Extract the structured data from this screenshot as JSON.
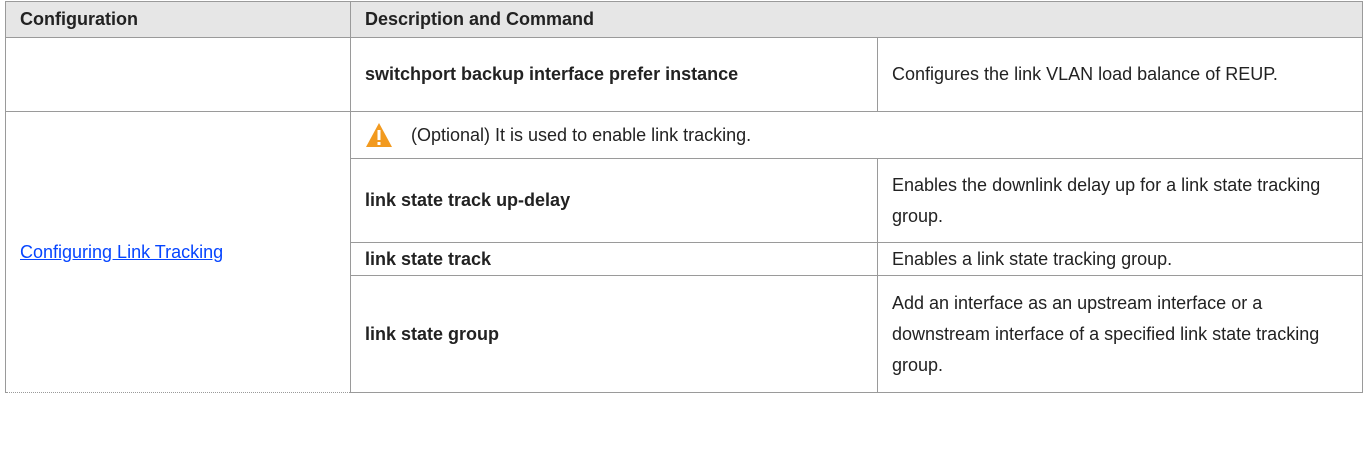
{
  "table": {
    "headers": {
      "configuration": "Configuration",
      "description_command": "Description and Command"
    },
    "rows": [
      {
        "command": "switchport backup interface prefer instance",
        "description": "Configures the link VLAN load balance of REUP."
      }
    ],
    "section": {
      "link_label": "Configuring Link Tracking",
      "note": "(Optional) It is used to enable link tracking.",
      "note_icon": "warning-icon",
      "rows": [
        {
          "command": "link state track up-delay",
          "description": "Enables the downlink delay up for a link state tracking group."
        },
        {
          "command": "link state track",
          "description": "Enables a link state tracking group."
        },
        {
          "command": "link state group",
          "description": "Add an interface as an upstream interface or a downstream interface of a specified link state tracking group."
        }
      ]
    }
  },
  "colors": {
    "header_bg": "#e6e6e6",
    "link": "#0645ff",
    "border": "#9a9a9a",
    "warning": "#f29a1f"
  }
}
